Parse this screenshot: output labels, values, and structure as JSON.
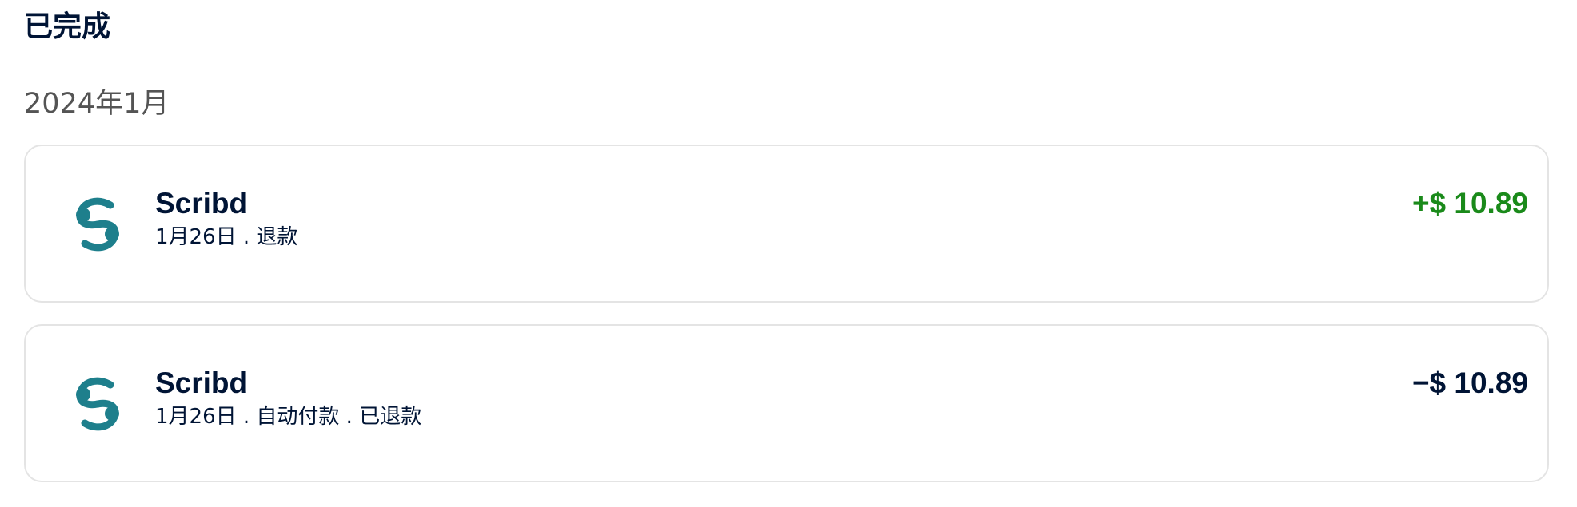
{
  "section": {
    "title": "已完成"
  },
  "month": {
    "label": "2024年1月"
  },
  "transactions": [
    {
      "merchant": "Scribd",
      "details": "1月26日 . 退款",
      "amount": "+$ 10.89",
      "amount_color": "#1a8a1a",
      "icon": "scribd-logo-icon"
    },
    {
      "merchant": "Scribd",
      "details": "1月26日 . 自动付款 . 已退款",
      "amount": "−$ 10.89",
      "amount_color": "#001435",
      "icon": "scribd-logo-icon"
    }
  ],
  "colors": {
    "brand_teal": "#1e7f8c",
    "text_primary": "#001435",
    "text_secondary": "#545454",
    "positive": "#1a8a1a",
    "card_border": "#e4e4e4"
  }
}
